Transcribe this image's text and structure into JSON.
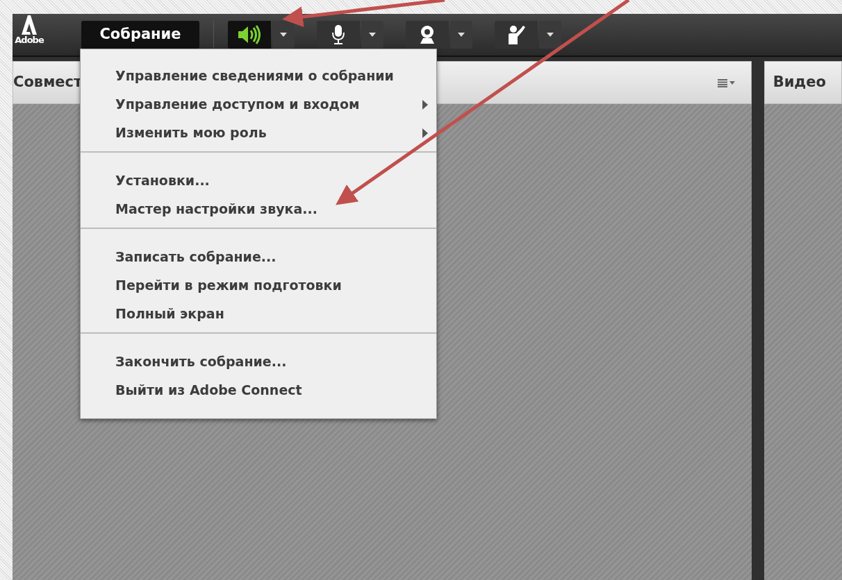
{
  "logo": {
    "text": "Adobe"
  },
  "toolbar": {
    "meeting_menu": {
      "label": "Собрание",
      "open": true
    },
    "devices": [
      {
        "kind": "speaker",
        "on": true
      },
      {
        "kind": "microphone",
        "on": false
      },
      {
        "kind": "camera",
        "on": false
      },
      {
        "kind": "raise-hand",
        "on": false
      }
    ]
  },
  "menu": {
    "groups": [
      [
        {
          "label": "Управление сведениями о собрании",
          "submenu": false
        },
        {
          "label": "Управление доступом и входом",
          "submenu": true
        },
        {
          "label": "Изменить мою роль",
          "submenu": true
        }
      ],
      [
        {
          "label": "Установки...",
          "submenu": false
        },
        {
          "label": "Мастер настройки звука...",
          "submenu": false
        }
      ],
      [
        {
          "label": "Записать собрание...",
          "submenu": false
        },
        {
          "label": "Перейти в режим подготовки",
          "submenu": false
        },
        {
          "label": "Полный экран",
          "submenu": false
        }
      ],
      [
        {
          "label": "Закончить собрание...",
          "submenu": false
        },
        {
          "label": "Выйти из Adobe Connect",
          "submenu": false
        }
      ]
    ]
  },
  "pods": [
    {
      "title": "Совмест",
      "options": true
    },
    {
      "title": "Видео",
      "options": false
    }
  ]
}
